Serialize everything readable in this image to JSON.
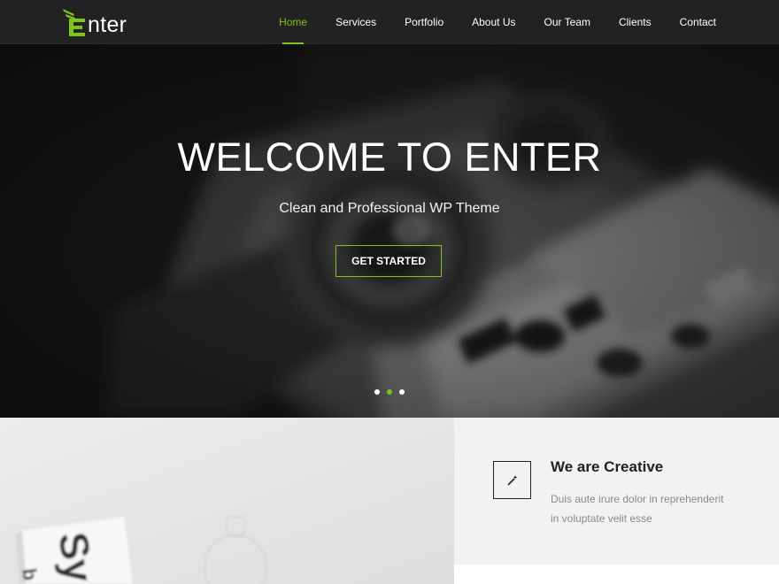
{
  "brand": {
    "name": "nter",
    "accent": "#7fc41c",
    "logo_icon": "winged-e-icon"
  },
  "nav": {
    "items": [
      {
        "label": "Home",
        "active": true
      },
      {
        "label": "Services"
      },
      {
        "label": "Portfolio"
      },
      {
        "label": "About Us"
      },
      {
        "label": "Our Team"
      },
      {
        "label": "Clients"
      },
      {
        "label": "Contact"
      }
    ]
  },
  "hero": {
    "title": "WELCOME TO ENTER",
    "subtitle": "Clean and Professional WP Theme",
    "button": "GET STARTED",
    "slides": 3,
    "active_slide": 2
  },
  "feature": {
    "icon": "magic-wand-icon",
    "title": "We are Creative",
    "text": "Duis aute irure dolor in reprehenderit in voluptate velit esse"
  }
}
